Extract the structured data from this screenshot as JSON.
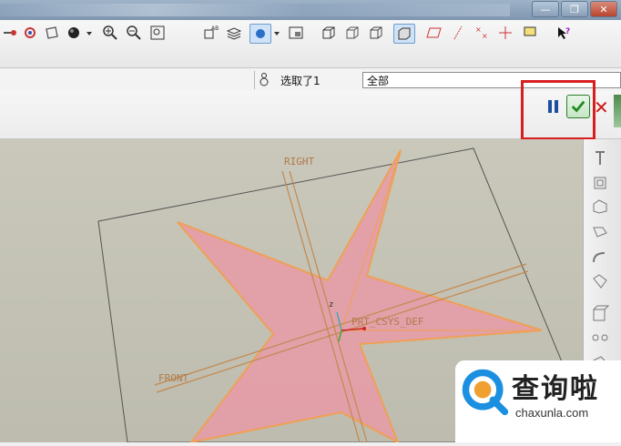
{
  "window": {
    "minimize_glyph": "—",
    "restore_glyph": "❐",
    "close_glyph": "✕"
  },
  "filter": {
    "status_text": "选取了1",
    "dropdown_value": "全部"
  },
  "dashboard": {
    "pause_label": "Pause",
    "ok_label": "OK",
    "cancel_glyph": "✕"
  },
  "viewport": {
    "labels": {
      "right": "RIGHT",
      "front": "FRONT",
      "csys": "PRT_CSYS_DEF",
      "axis_z": "z"
    }
  },
  "watermark": {
    "title": "查询啦",
    "url": "chaxunla.com"
  },
  "colors": {
    "star_fill": "#e79aa7",
    "star_edge": "#f0a055",
    "highlight_box": "#d81e1e",
    "ok_green": "#2d7b2d"
  }
}
